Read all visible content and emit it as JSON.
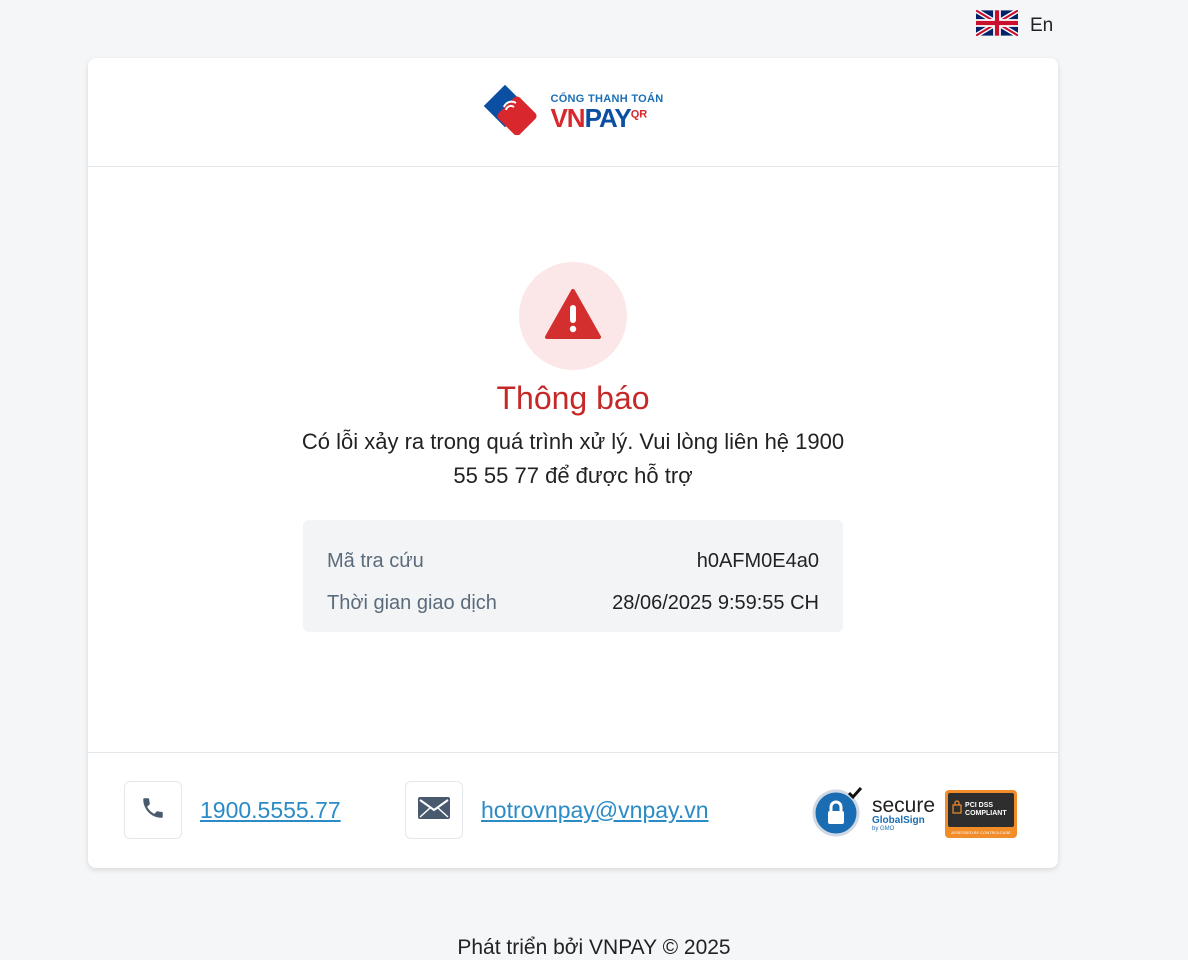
{
  "language": {
    "label": "En",
    "icon": "uk-flag-icon"
  },
  "brand": {
    "top_text": "CỔNG THANH TOÁN",
    "vn": "VN",
    "pay": "PAY",
    "qr": "QR"
  },
  "alert": {
    "icon": "warning-icon",
    "title": "Thông báo",
    "message": "Có lỗi xảy ra trong quá trình xử lý. Vui lòng liên hệ 1900 55 55 77 để được hỗ trợ"
  },
  "info": {
    "rows": [
      {
        "label": "Mã tra cứu",
        "value": "h0AFM0E4a0"
      },
      {
        "label": "Thời gian giao dịch",
        "value": "28/06/2025 9:59:55 CH"
      }
    ]
  },
  "footer": {
    "phone": "1900.5555.77",
    "email": "hotrovnpay@vnpay.vn",
    "secure_label": "secure",
    "globalsign_label": "GlobalSign",
    "gmo_label": "by GMO",
    "pci_label_1": "PCI DSS",
    "pci_label_2": "COMPLIANT",
    "pci_assessed": "ASSESSED BY CONTROLCASE"
  },
  "developed_by": "Phát triển bởi VNPAY © 2025",
  "colors": {
    "accent_red": "#c62828",
    "link_blue": "#2a8bc6",
    "alert_bg": "#fbe7e7"
  }
}
